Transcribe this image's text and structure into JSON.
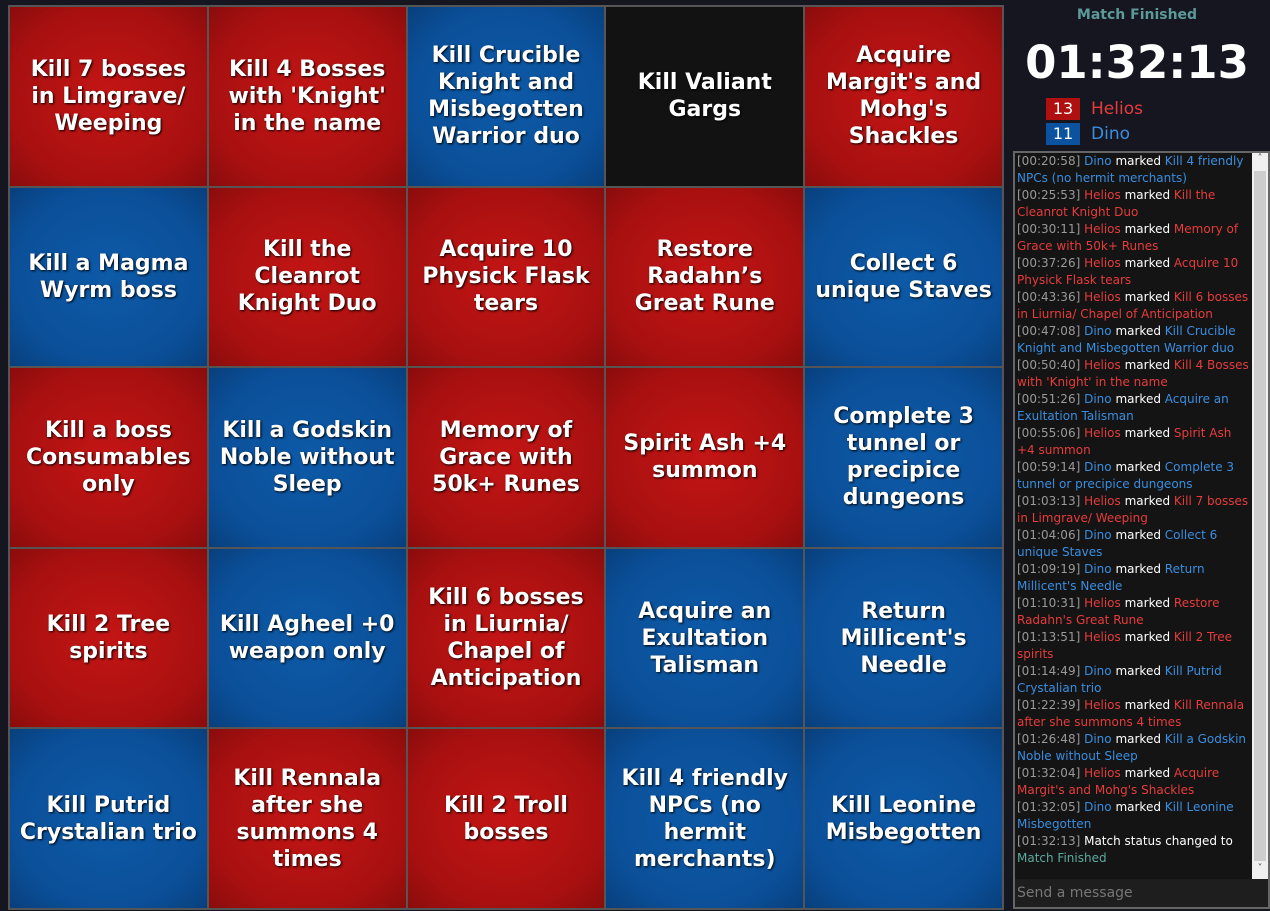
{
  "board": [
    {
      "text": "Kill 7 bosses in Limgrave/ Weeping",
      "team": "red"
    },
    {
      "text": "Kill 4 Bosses with 'Knight' in the name",
      "team": "red"
    },
    {
      "text": "Kill Crucible Knight and Misbegotten Warrior duo",
      "team": "blue"
    },
    {
      "text": "Kill Valiant Gargs",
      "team": "none"
    },
    {
      "text": "Acquire Margit's and Mohg's Shackles",
      "team": "red"
    },
    {
      "text": "Kill a Magma Wyrm boss",
      "team": "blue"
    },
    {
      "text": "Kill the Cleanrot Knight Duo",
      "team": "red"
    },
    {
      "text": "Acquire 10 Physick Flask tears",
      "team": "red"
    },
    {
      "text": "Restore Radahn’s Great Rune",
      "team": "red"
    },
    {
      "text": "Collect 6 unique Staves",
      "team": "blue"
    },
    {
      "text": "Kill a boss Consumables only",
      "team": "red"
    },
    {
      "text": "Kill a Godskin Noble without Sleep",
      "team": "blue"
    },
    {
      "text": "Memory of Grace with 50k+ Runes",
      "team": "red"
    },
    {
      "text": "Spirit Ash +4 summon",
      "team": "red"
    },
    {
      "text": "Complete 3 tunnel or precipice dungeons",
      "team": "blue"
    },
    {
      "text": "Kill 2 Tree spirits",
      "team": "red"
    },
    {
      "text": "Kill Agheel +0 weapon only",
      "team": "blue"
    },
    {
      "text": "Kill 6 bosses in Liurnia/ Chapel of Anticipation",
      "team": "red"
    },
    {
      "text": "Acquire an Exultation Talisman",
      "team": "blue"
    },
    {
      "text": "Return Millicent's Needle",
      "team": "blue"
    },
    {
      "text": "Kill Putrid Crystalian trio",
      "team": "blue"
    },
    {
      "text": "Kill Rennala after she summons 4 times",
      "team": "red"
    },
    {
      "text": "Kill 2 Troll bosses",
      "team": "red"
    },
    {
      "text": "Kill 4 friendly NPCs (no hermit merchants)",
      "team": "blue"
    },
    {
      "text": "Kill Leonine Misbegotten",
      "team": "blue"
    }
  ],
  "match": {
    "status": "Match Finished",
    "timer": "01:32:13"
  },
  "teams": [
    {
      "name": "Helios",
      "score": "13",
      "color": "#b01010"
    },
    {
      "name": "Dino",
      "score": "11",
      "color": "#0b52a0"
    }
  ],
  "log": {
    "marked_word": "marked",
    "entries": [
      {
        "time": "[00:20:58]",
        "player": "Dino",
        "team": "b",
        "goal": "Kill 4 friendly NPCs (no hermit merchants)"
      },
      {
        "time": "[00:25:53]",
        "player": "Helios",
        "team": "r",
        "goal": "Kill the Cleanrot Knight Duo"
      },
      {
        "time": "[00:30:11]",
        "player": "Helios",
        "team": "r",
        "goal": "Memory of Grace with 50k+ Runes"
      },
      {
        "time": "[00:37:26]",
        "player": "Helios",
        "team": "r",
        "goal": "Acquire 10 Physick Flask tears"
      },
      {
        "time": "[00:43:36]",
        "player": "Helios",
        "team": "r",
        "goal": "Kill 6 bosses in Liurnia/ Chapel of Anticipation"
      },
      {
        "time": "[00:47:08]",
        "player": "Dino",
        "team": "b",
        "goal": "Kill Crucible Knight and Misbegotten Warrior duo"
      },
      {
        "time": "[00:50:40]",
        "player": "Helios",
        "team": "r",
        "goal": "Kill 4 Bosses with 'Knight' in the name"
      },
      {
        "time": "[00:51:26]",
        "player": "Dino",
        "team": "b",
        "goal": "Acquire an Exultation Talisman"
      },
      {
        "time": "[00:55:06]",
        "player": "Helios",
        "team": "r",
        "goal": "Spirit Ash +4 summon"
      },
      {
        "time": "[00:59:14]",
        "player": "Dino",
        "team": "b",
        "goal": "Complete 3 tunnel or precipice dungeons"
      },
      {
        "time": "[01:03:13]",
        "player": "Helios",
        "team": "r",
        "goal": "Kill 7 bosses in Limgrave/ Weeping"
      },
      {
        "time": "[01:04:06]",
        "player": "Dino",
        "team": "b",
        "goal": "Collect 6 unique Staves"
      },
      {
        "time": "[01:09:19]",
        "player": "Dino",
        "team": "b",
        "goal": "Return Millicent's Needle"
      },
      {
        "time": "[01:10:31]",
        "player": "Helios",
        "team": "r",
        "goal": "Restore Radahn's Great Rune"
      },
      {
        "time": "[01:13:51]",
        "player": "Helios",
        "team": "r",
        "goal": "Kill 2 Tree spirits"
      },
      {
        "time": "[01:14:49]",
        "player": "Dino",
        "team": "b",
        "goal": "Kill Putrid Crystalian trio"
      },
      {
        "time": "[01:22:39]",
        "player": "Helios",
        "team": "r",
        "goal": "Kill Rennala after she summons 4 times"
      },
      {
        "time": "[01:26:48]",
        "player": "Dino",
        "team": "b",
        "goal": "Kill a Godskin Noble without Sleep"
      },
      {
        "time": "[01:32:04]",
        "player": "Helios",
        "team": "r",
        "goal": "Acquire Margit's and Mohg's Shackles"
      },
      {
        "time": "[01:32:05]",
        "player": "Dino",
        "team": "b",
        "goal": "Kill Leonine Misbegotten"
      }
    ],
    "status_entry": {
      "time": "[01:32:13]",
      "text": "Match status changed to",
      "value": "Match Finished"
    }
  },
  "chat": {
    "placeholder": "Send a message",
    "value": ""
  }
}
